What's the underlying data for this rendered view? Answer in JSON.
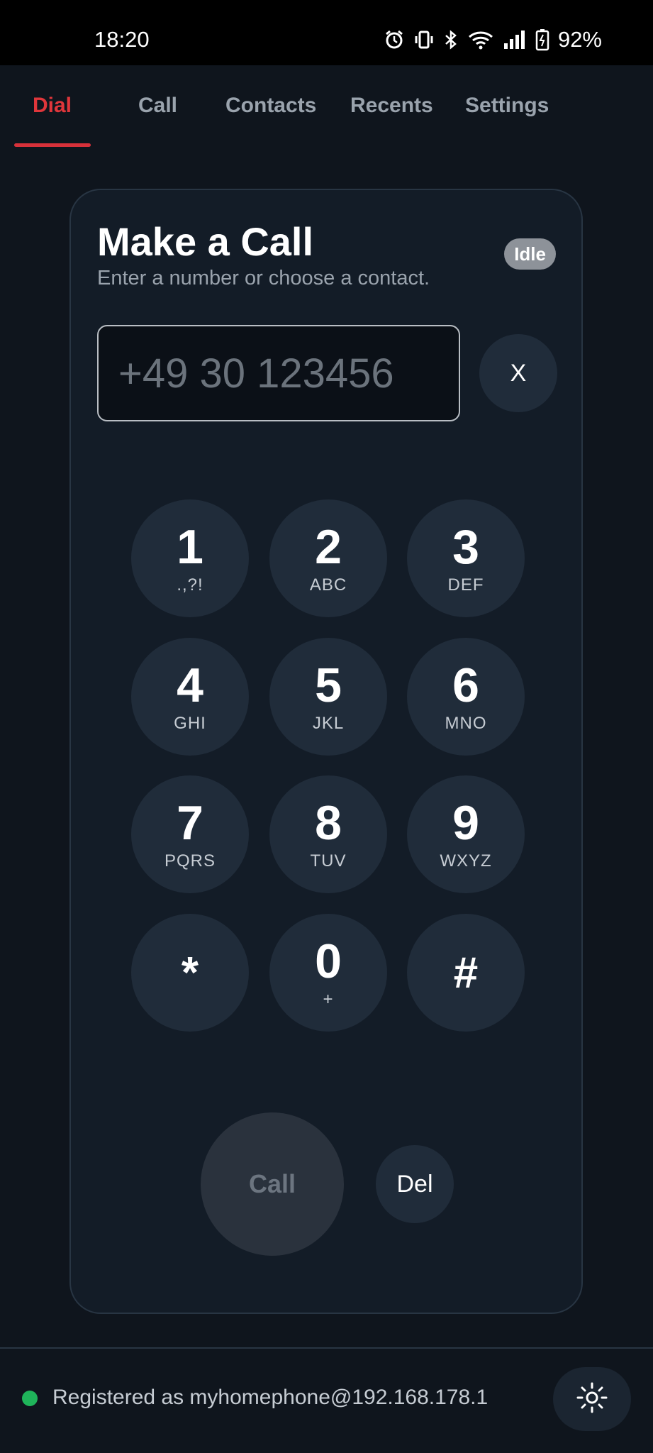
{
  "status_bar": {
    "time": "18:20",
    "battery": "92%",
    "icons": [
      "alarm-icon",
      "vibrate-icon",
      "bluetooth-icon",
      "wifi-icon",
      "signal-icon",
      "battery-icon"
    ]
  },
  "tabs": [
    {
      "label": "Dial",
      "active": true
    },
    {
      "label": "Call",
      "active": false
    },
    {
      "label": "Contacts",
      "active": false
    },
    {
      "label": "Recents",
      "active": false
    },
    {
      "label": "Settings",
      "active": false
    }
  ],
  "card": {
    "title": "Make a Call",
    "subtitle": "Enter a number or choose a contact.",
    "status_badge": "Idle",
    "number_input": {
      "value": "",
      "placeholder": "+49 30 123456"
    },
    "clear_label": "X"
  },
  "keypad": [
    {
      "digit": "1",
      "letters": ".,?!"
    },
    {
      "digit": "2",
      "letters": "ABC"
    },
    {
      "digit": "3",
      "letters": "DEF"
    },
    {
      "digit": "4",
      "letters": "GHI"
    },
    {
      "digit": "5",
      "letters": "JKL"
    },
    {
      "digit": "6",
      "letters": "MNO"
    },
    {
      "digit": "7",
      "letters": "PQRS"
    },
    {
      "digit": "8",
      "letters": "TUV"
    },
    {
      "digit": "9",
      "letters": "WXYZ"
    },
    {
      "digit": "*",
      "letters": ""
    },
    {
      "digit": "0",
      "letters": "+"
    },
    {
      "digit": "#",
      "letters": ""
    }
  ],
  "actions": {
    "call_label": "Call",
    "delete_label": "Del"
  },
  "footer": {
    "registration_text": "Registered as myhomephone@192.168.178.1",
    "status_color": "#1fb45a",
    "theme_icon": "sun-icon"
  },
  "colors": {
    "accent": "#e0363b",
    "background": "#0f151d",
    "card": "#131c27",
    "key": "#202c3a"
  }
}
